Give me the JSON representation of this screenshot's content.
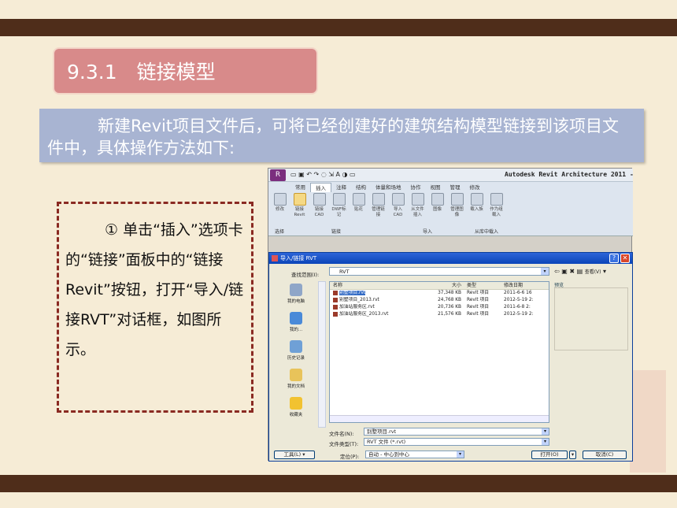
{
  "slide": {
    "section_title": "9.3.1　链接模型",
    "intro_text": "新建Revit项目文件后，可将已经创建好的建筑结构模型链接到该项目文件中，具体操作方法如下:",
    "step_text": "① 单击“插入”选项卡的“链接”面板中的“链接Revit”按钮，打开“导入/链接RVT”对话框，如图所示。"
  },
  "revit": {
    "window_title": "Autodesk Revit Architecture 2011 -",
    "tabs": [
      "常用",
      "插入",
      "注释",
      "结构",
      "体量和场地",
      "协作",
      "视图",
      "管理",
      "修改"
    ],
    "active_tab": "插入",
    "tools": [
      {
        "label": "修改"
      },
      {
        "label": "链接Revit",
        "highlighted": true
      },
      {
        "label": "链接CAD"
      },
      {
        "label": "DWF标记"
      },
      {
        "label": "贴花"
      },
      {
        "label": "管理链接"
      },
      {
        "label": "导入CAD"
      },
      {
        "label": "从文件插入"
      },
      {
        "label": "图像"
      },
      {
        "label": "管理图像"
      },
      {
        "label": "载入族"
      },
      {
        "label": "作为组载入"
      }
    ],
    "panels": [
      "选择",
      "链接",
      "导入",
      "从库中载入"
    ]
  },
  "dialog": {
    "title": "导入/链接 RVT",
    "look_in_label": "查找范围(I):",
    "look_in_value": "RVT",
    "views_label": "查看(V)",
    "preview_label": "预览",
    "places": [
      "我的电脑",
      "我的...",
      "历史记录",
      "我的文档",
      "收藏夹"
    ],
    "columns": [
      "名称",
      "大小",
      "类型",
      "修改日期"
    ],
    "files": [
      {
        "name": "别墅项目.rvt",
        "size": "37,348 KB",
        "type": "Revit 项目",
        "date": "2011-6-6 16",
        "selected": true
      },
      {
        "name": "别墅项目_2013.rvt",
        "size": "24,768 KB",
        "type": "Revit 项目",
        "date": "2012-5-19 2:"
      },
      {
        "name": "加油站服务区.rvt",
        "size": "20,736 KB",
        "type": "Revit 项目",
        "date": "2011-6-8 2:"
      },
      {
        "name": "加油站服务区_2013.rvt",
        "size": "21,576 KB",
        "type": "Revit 项目",
        "date": "2012-5-19 2:"
      }
    ],
    "file_name_label": "文件名(N):",
    "file_name_value": "别墅项目.rvt",
    "file_type_label": "文件类型(T):",
    "file_type_value": "RVT 文件 (*.rvt)",
    "position_label": "定位(P):",
    "position_value": "自动 - 中心到中心",
    "tools_button": "工具(L)",
    "open_button": "打开(O)",
    "cancel_button": "取消(C)"
  }
}
